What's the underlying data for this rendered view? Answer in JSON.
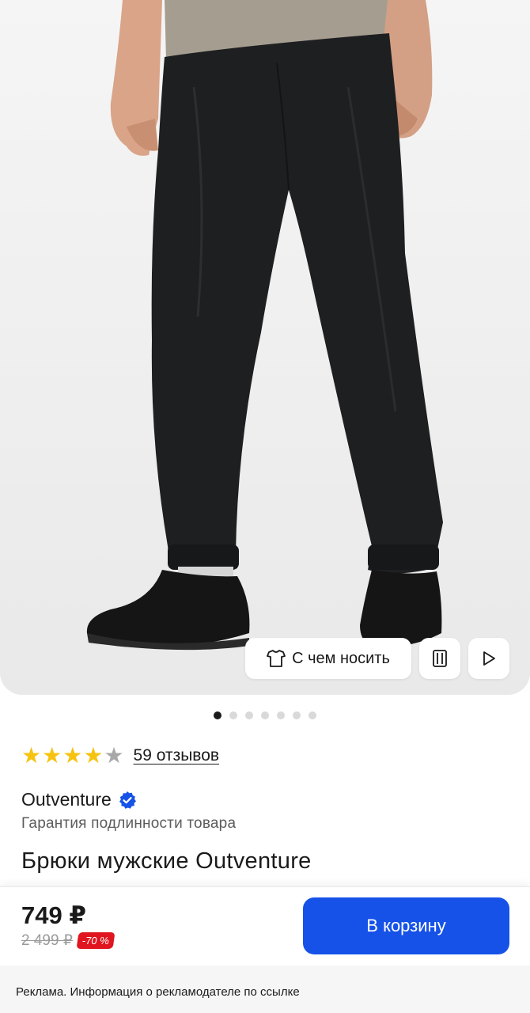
{
  "gallery": {
    "image_alt": "Men's black pants product photo",
    "slides_total": 7,
    "slide_active": 0,
    "outfit_label": "С чем носить",
    "icons": [
      "tshirt-icon",
      "compare-icon",
      "play-icon"
    ]
  },
  "rating": {
    "stars": 4,
    "max": 5,
    "reviews_label": "59 отзывов"
  },
  "product": {
    "brand": "Outventure",
    "guarantee": "Гарантия подлинности товара",
    "title": "Брюки мужские Outventure"
  },
  "buybar": {
    "price": "749 ₽",
    "old_price": "2 499 ₽",
    "discount": "-70 %",
    "cart_label": "В корзину"
  },
  "ad": {
    "text": "Реклама. Информация о рекламодателе по ссылке"
  },
  "colors": {
    "accent": "#1652e8",
    "star": "#f6c310",
    "discount": "#e0151f",
    "verified": "#1652e8"
  }
}
